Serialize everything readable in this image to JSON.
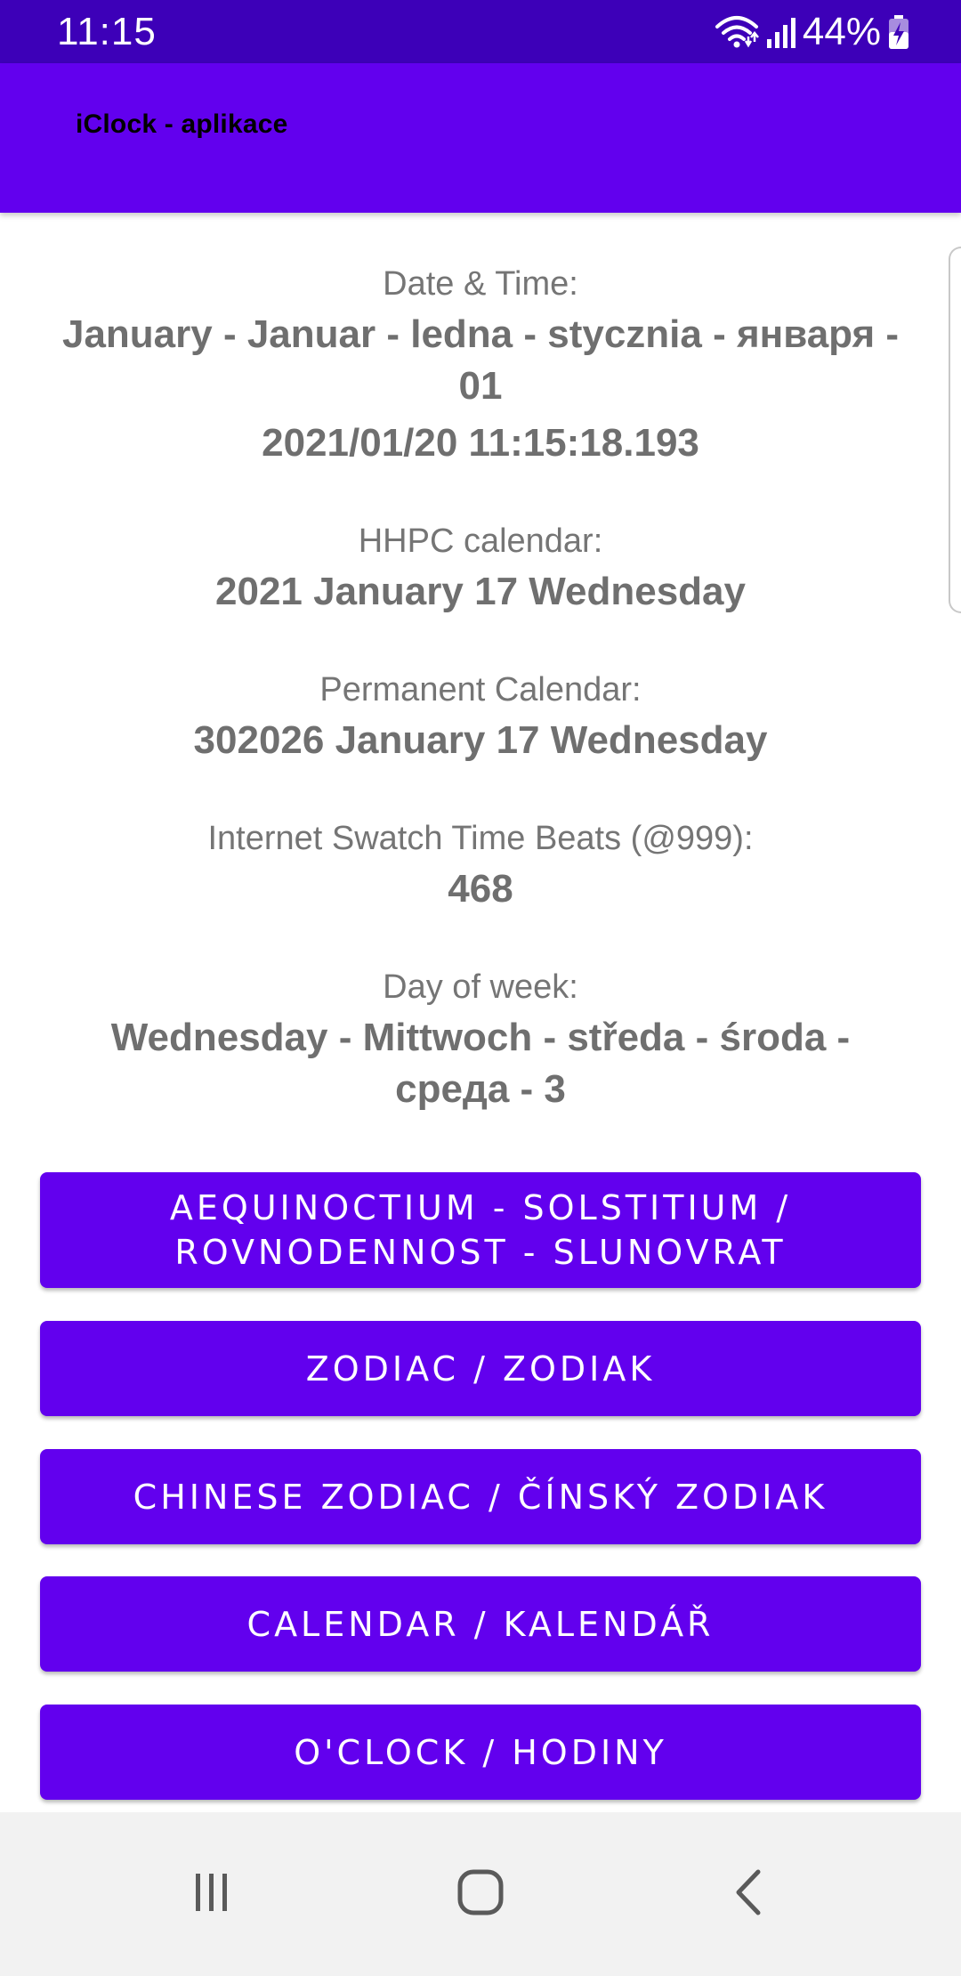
{
  "status_bar": {
    "time": "11:15",
    "battery": "44%",
    "icons": [
      "wifi-icon",
      "signal-icon",
      "battery-charging-icon"
    ]
  },
  "app_bar": {
    "title": "iClock - aplikace"
  },
  "info": {
    "date_time": {
      "label": "Date & Time:",
      "value_line1": "January - Januar - ledna - stycznia - января - 01",
      "value_line2": "2021/01/20 11:15:18.193"
    },
    "hhpc": {
      "label": "HHPC calendar:",
      "value": "2021 January 17 Wednesday"
    },
    "permanent": {
      "label": "Permanent Calendar:",
      "value": "302026 January 17 Wednesday"
    },
    "swatch": {
      "label": "Internet Swatch Time Beats (@999):",
      "value": "468"
    },
    "day_of_week": {
      "label": "Day of week:",
      "value": "Wednesday - Mittwoch - středa - środa - среда - 3"
    }
  },
  "buttons": {
    "equinox": "AEQUINOCTIUM - SOLSTITIUM / ROVNODENNOST - SLUNOVRAT",
    "zodiac": "ZODIAC / ZODIAK",
    "chinese_zodiac": "CHINESE ZODIAC / ČÍNSKÝ ZODIAK",
    "calendar": "CALENDAR / KALENDÁŘ",
    "oclock": "O'CLOCK / HODINY"
  },
  "nav": {
    "icons": [
      "recent-apps-icon",
      "home-icon",
      "back-icon"
    ]
  },
  "colors": {
    "status_bar": "#3d00b8",
    "primary": "#6200ee",
    "text_gray": "#757575"
  }
}
